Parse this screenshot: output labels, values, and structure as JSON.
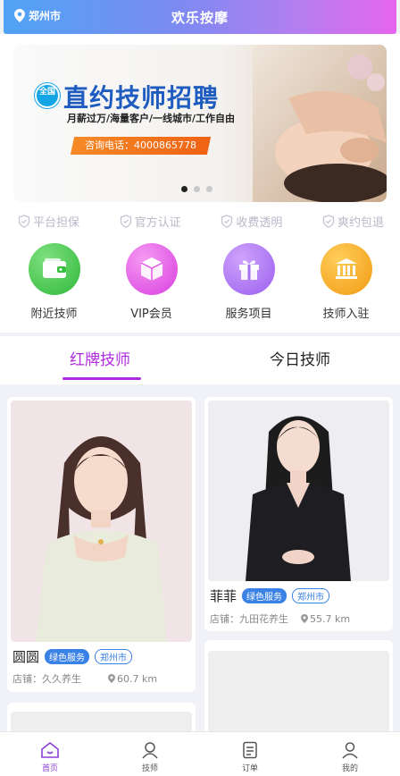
{
  "header": {
    "location": "郑州市",
    "title": "欢乐按摩"
  },
  "banner": {
    "badge": "全国",
    "headline": "直约技师招聘",
    "subline": "月薪过万/海量客户/一线城市/工作自由",
    "phone": "咨询电话：4000865778",
    "slide_count": 3,
    "active_slide": 1
  },
  "guarantees": [
    "平台担保",
    "官方认证",
    "收费透明",
    "爽约包退"
  ],
  "quick_entries": [
    {
      "label": "附近技师",
      "icon": "wallet-icon",
      "color": "#3ec94a"
    },
    {
      "label": "VIP会员",
      "icon": "cube-icon",
      "color": "#e14fe4"
    },
    {
      "label": "服务项目",
      "icon": "gift-icon",
      "color": "#a86cf0"
    },
    {
      "label": "技师入驻",
      "icon": "bank-icon",
      "color": "#f3a21b"
    }
  ],
  "tabs": [
    "红牌技师",
    "今日技师"
  ],
  "therapists": [
    {
      "name": "圆圆",
      "service_tag": "绿色服务",
      "city_tag": "郑州市",
      "shop": "店铺：久久养生",
      "distance": "60.7 km"
    },
    {
      "name": "菲菲",
      "service_tag": "绿色服务",
      "city_tag": "郑州市",
      "shop": "店铺：九田花养生",
      "distance": "55.7 km"
    }
  ],
  "bottom_nav": [
    {
      "label": "首页",
      "icon": "home-icon",
      "active": true
    },
    {
      "label": "技师",
      "icon": "therapist-icon",
      "active": false
    },
    {
      "label": "订单",
      "icon": "order-icon",
      "active": false
    },
    {
      "label": "我的",
      "icon": "user-icon",
      "active": false
    }
  ]
}
